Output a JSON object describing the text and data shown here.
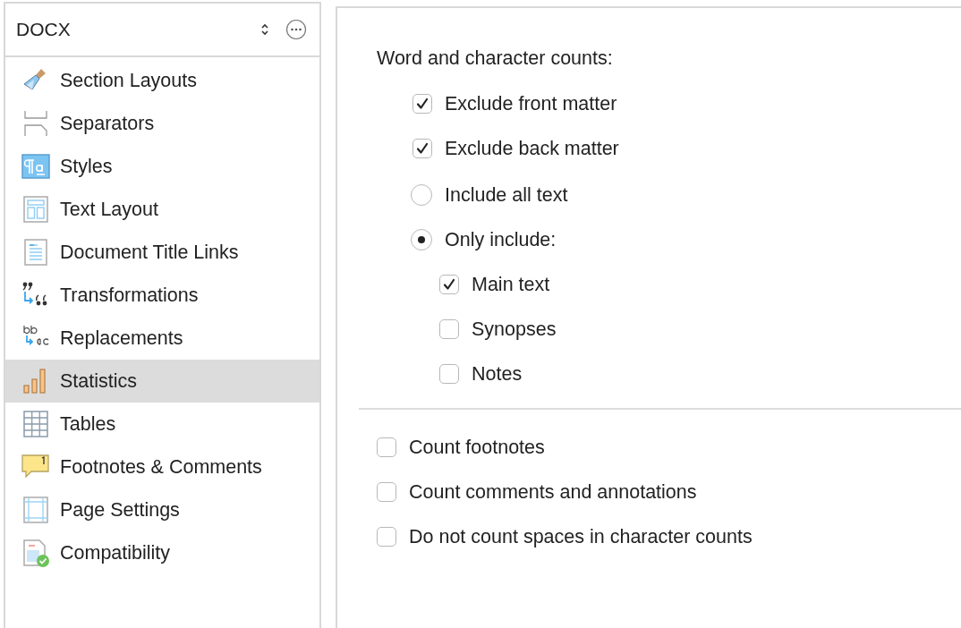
{
  "sidebar": {
    "format": "DOCX",
    "items": [
      {
        "label": "Section Layouts",
        "selected": false
      },
      {
        "label": "Separators",
        "selected": false
      },
      {
        "label": "Styles",
        "selected": false
      },
      {
        "label": "Text Layout",
        "selected": false
      },
      {
        "label": "Document Title Links",
        "selected": false
      },
      {
        "label": "Transformations",
        "selected": false
      },
      {
        "label": "Replacements",
        "selected": false
      },
      {
        "label": "Statistics",
        "selected": true
      },
      {
        "label": "Tables",
        "selected": false
      },
      {
        "label": "Footnotes & Comments",
        "selected": false
      },
      {
        "label": "Page Settings",
        "selected": false
      },
      {
        "label": "Compatibility",
        "selected": false
      }
    ]
  },
  "panel": {
    "heading": "Word and character counts:",
    "options": [
      {
        "kind": "checkbox",
        "label": "Exclude front matter",
        "checked": true
      },
      {
        "kind": "checkbox",
        "label": "Exclude back matter",
        "checked": true
      },
      {
        "kind": "radio",
        "label": "Include all text",
        "selected": false
      },
      {
        "kind": "radio",
        "label": "Only include:",
        "selected": true,
        "children": [
          {
            "kind": "checkbox",
            "label": "Main text",
            "checked": true
          },
          {
            "kind": "checkbox",
            "label": "Synopses",
            "checked": false
          },
          {
            "kind": "checkbox",
            "label": "Notes",
            "checked": false
          }
        ]
      }
    ],
    "extra_options": [
      {
        "kind": "checkbox",
        "label": "Count footnotes",
        "checked": false
      },
      {
        "kind": "checkbox",
        "label": "Count comments and annotations",
        "checked": false
      },
      {
        "kind": "checkbox",
        "label": "Do not count spaces in character counts",
        "checked": false
      }
    ]
  }
}
